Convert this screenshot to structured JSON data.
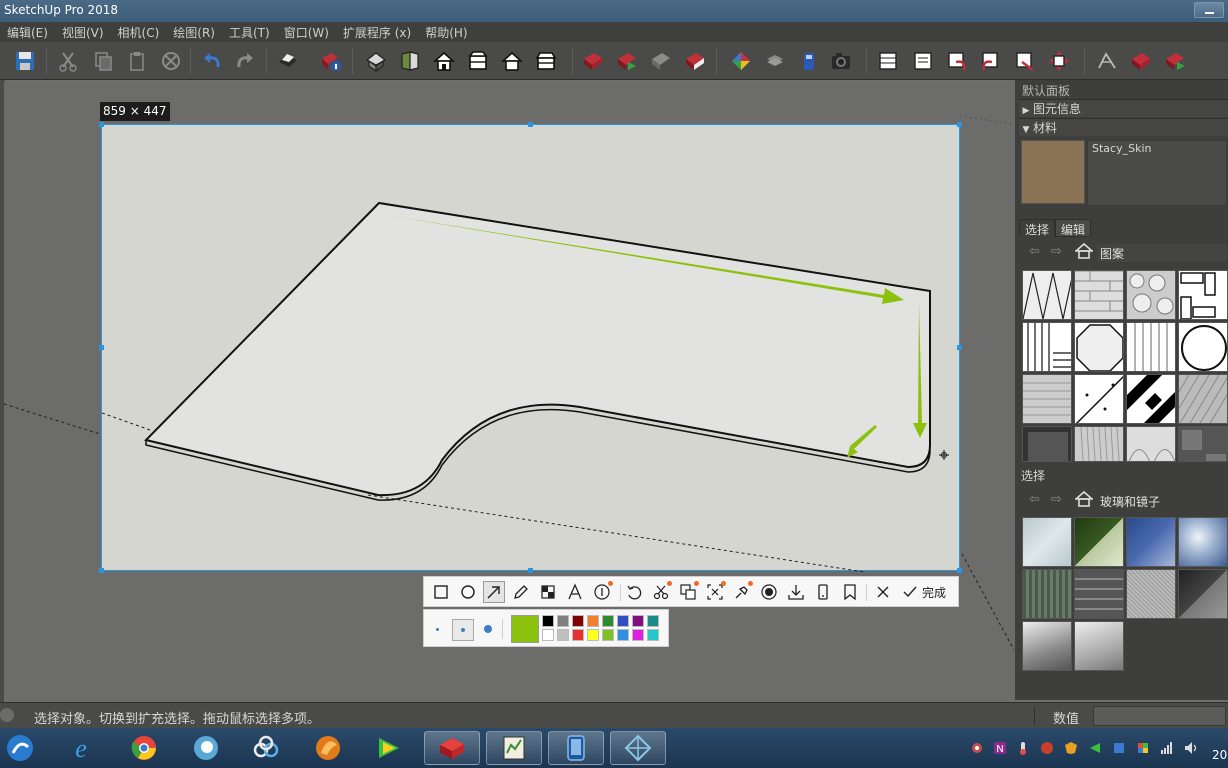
{
  "app": {
    "title": "SketchUp Pro 2018"
  },
  "menu": [
    "编辑(E)",
    "视图(V)",
    "相机(C)",
    "绘图(R)",
    "工具(T)",
    "窗口(W)",
    "扩展程序 (x)",
    "帮助(H)"
  ],
  "toolbar": {
    "icons": [
      "save-icon",
      "cut-icon",
      "copy-icon",
      "paste-icon",
      "erase-icon",
      "undo-icon",
      "redo-icon",
      "print-icon",
      "model-info-icon",
      "iso-view-icon",
      "front-view-icon",
      "home-view-icon",
      "top-view-icon",
      "right-view-icon",
      "back-view-icon",
      "components-icon",
      "add-location-icon",
      "toggle-terrain-icon",
      "extension-icon",
      "styles-icon",
      "layers-icon",
      "3d-warehouse-icon",
      "camera-icon",
      "section-icon",
      "section-plane-icon",
      "undo-section-icon",
      "redo-section-icon",
      "cut-section-icon",
      "reset-section-icon",
      "sandbox-icon",
      "warehouse-get-icon",
      "warehouse-share-icon"
    ]
  },
  "capture": {
    "size_label": "859 × 447",
    "colors": {
      "border": "#2b96dd",
      "arrow": "#8cc10e",
      "background": "#d6d6d0",
      "surface": "#e2e2e0"
    }
  },
  "annotation_toolbar": {
    "tools": [
      {
        "name": "rectangle-tool-icon",
        "active": false
      },
      {
        "name": "ellipse-tool-icon",
        "active": false
      },
      {
        "name": "arrow-tool-icon",
        "active": true
      },
      {
        "name": "pencil-tool-icon",
        "active": false
      },
      {
        "name": "mosaic-tool-icon",
        "active": false
      },
      {
        "name": "text-tool-icon",
        "active": false
      },
      {
        "name": "number-tool-icon",
        "active": false
      },
      {
        "name": "undo-icon",
        "active": false
      },
      {
        "name": "cut-ocr-icon",
        "active": false
      },
      {
        "name": "translate-icon",
        "active": false
      },
      {
        "name": "long-screenshot-icon",
        "active": false
      },
      {
        "name": "pin-icon",
        "active": false
      },
      {
        "name": "record-icon",
        "active": false
      },
      {
        "name": "download-icon",
        "active": false
      },
      {
        "name": "phone-icon",
        "active": false
      },
      {
        "name": "bookmark-icon",
        "active": false
      },
      {
        "name": "close-icon",
        "active": false
      },
      {
        "name": "check-icon",
        "active": false
      }
    ],
    "finish_label": "完成",
    "current_color": "#8cc10e",
    "palette": [
      "#000000",
      "#808080",
      "#800000",
      "#f08030",
      "#2e8b2e",
      "#3050c0",
      "#801080",
      "#1a8a8a",
      "#ffffff",
      "#c0c0c0",
      "#e83030",
      "#ffff20",
      "#80c020",
      "#3090e0",
      "#e020e0",
      "#20c8c8"
    ]
  },
  "panel": {
    "title": "默认面板",
    "entity_info": "图元信息",
    "materials": "材料",
    "material_name": "Stacy_Skin",
    "tabs": [
      "选择",
      "编辑"
    ],
    "location1": "图案",
    "select_label": "选择",
    "location2": "玻璃和镜子"
  },
  "status": {
    "message": "选择对象。切换到扩充选择。拖动鼠标选择多项。",
    "value_label": "数值"
  },
  "taskbar": {
    "apps": [
      "ie-icon",
      "chrome-icon",
      "edge-icon",
      "baidu-netdisk-icon",
      "fox-icon",
      "media-player-icon",
      "sketchup-icon",
      "chart-app-icon",
      "tablet-icon",
      "layout-icon"
    ],
    "clock": "20"
  }
}
